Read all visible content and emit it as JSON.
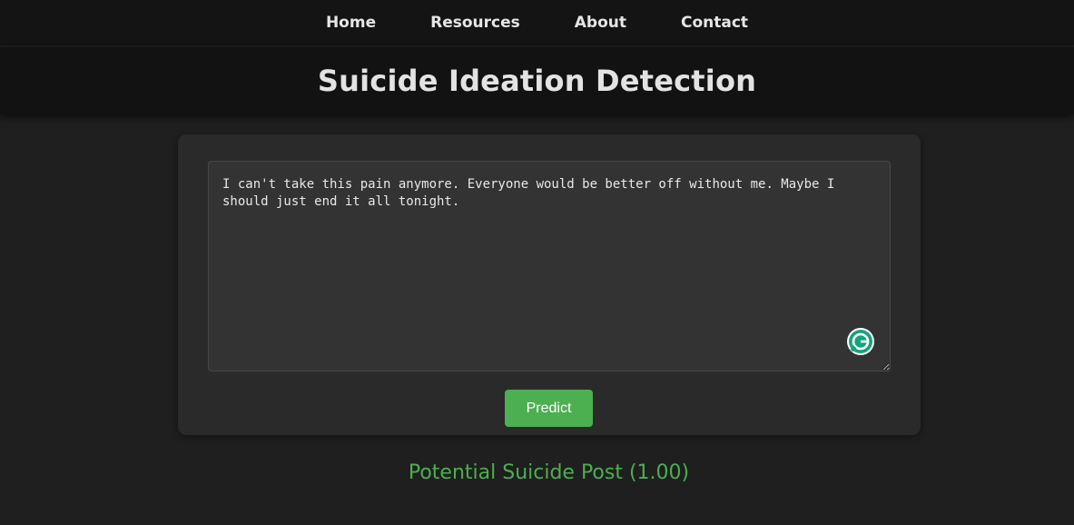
{
  "nav": {
    "items": [
      {
        "label": "Home"
      },
      {
        "label": "Resources"
      },
      {
        "label": "About"
      },
      {
        "label": "Contact"
      }
    ]
  },
  "header": {
    "title": "Suicide Ideation Detection"
  },
  "form": {
    "input_value": "I can't take this pain anymore. Everyone would be better off without me. Maybe I should just end it all tonight.",
    "grammarly_icon": "grammarly-g-icon",
    "predict_label": "Predict"
  },
  "result": {
    "text": "Potential Suicide Post (1.00)",
    "color": "#4caf50"
  },
  "colors": {
    "background": "#1f1f1f",
    "nav_bg": "#141414",
    "accent": "#4caf50",
    "card_bg": "#2a2a2a",
    "grammarly": "#15a37f"
  }
}
